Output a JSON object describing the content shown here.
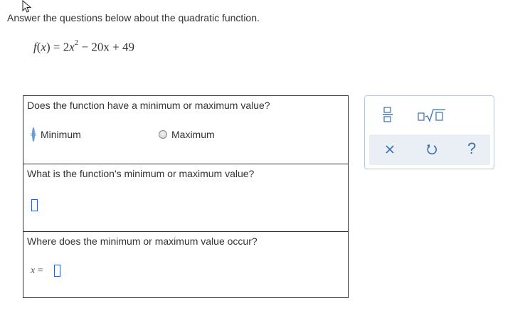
{
  "instruction": "Answer the questions below about the quadratic function.",
  "formula": {
    "lhs_f": "f",
    "lhs_paren_open": "(",
    "lhs_x": "x",
    "lhs_paren_close": ")",
    "equals": " = 2",
    "x": "x",
    "exponent": "2",
    "rest": " − 20x + 49"
  },
  "questions": [
    {
      "prompt": "Does the function have a minimum or maximum value?",
      "options": [
        "Minimum",
        "Maximum"
      ]
    },
    {
      "prompt": "What is the function's minimum or maximum value?",
      "value": ""
    },
    {
      "prompt": "Where does the minimum or maximum value occur?",
      "var_label": "x",
      "eq": " =",
      "value": ""
    }
  ],
  "palette": {
    "help_label": "?",
    "icons": [
      "fraction-icon",
      "sqrt-icon",
      "close-icon",
      "undo-icon",
      "help-icon"
    ],
    "accent": "#3a6fb0",
    "tool_row_bg": "#e9eff5"
  },
  "colors": {
    "input_border": "#2a5bd7",
    "text": "#333333"
  }
}
